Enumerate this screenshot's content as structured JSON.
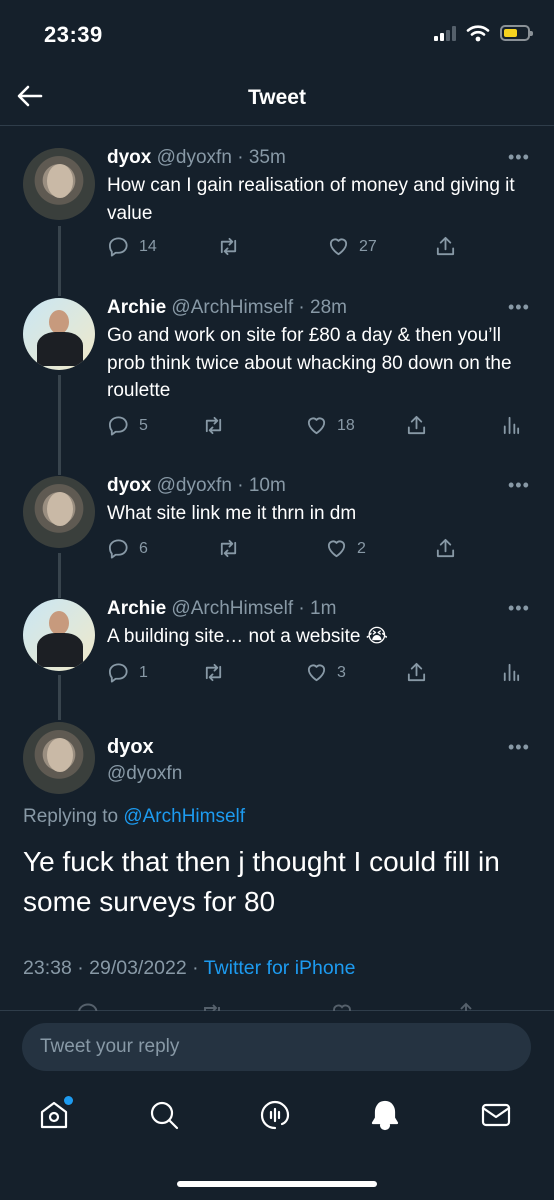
{
  "status_bar": {
    "time": "23:39"
  },
  "header": {
    "title": "Tweet"
  },
  "thread": [
    {
      "name": "dyox",
      "handle": "@dyoxfn",
      "time": "35m",
      "text": "How can I gain realisation of money and giving it value",
      "replies": "14",
      "retweets": "",
      "likes": "27",
      "show_analytics": false
    },
    {
      "name": "Archie",
      "handle": "@ArchHimself",
      "time": "28m",
      "text": "Go and work on site for £80 a day & then you’ll prob think twice about whacking 80 down on the roulette",
      "replies": "5",
      "retweets": "",
      "likes": "18",
      "show_analytics": true
    },
    {
      "name": "dyox",
      "handle": "@dyoxfn",
      "time": "10m",
      "text": "What site link me it thrn in dm",
      "replies": "6",
      "retweets": "",
      "likes": "2",
      "show_analytics": false
    },
    {
      "name": "Archie",
      "handle": "@ArchHimself",
      "time": "1m",
      "text": "A building site… not a website 😭",
      "replies": "1",
      "retweets": "",
      "likes": "3",
      "show_analytics": true
    }
  ],
  "main_tweet": {
    "name": "dyox",
    "handle": "@dyoxfn",
    "replying_prefix": "Replying to ",
    "replying_to": "@ArchHimself",
    "text": "Ye fuck that then j thought I could fill in some surveys for 80",
    "timestamp": "23:38 · 29/03/2022 · ",
    "source": "Twitter for iPhone"
  },
  "reply_bar": {
    "placeholder": "Tweet your reply"
  },
  "tab_bar": {
    "items": [
      "home-icon",
      "search-icon",
      "spaces-icon",
      "notifications-icon",
      "messages-icon"
    ],
    "home_has_dot": true
  },
  "colors": {
    "background": "#15202b",
    "accent": "#1d9bf0",
    "secondary_text": "#8899a6",
    "divider": "#2f3d4a"
  }
}
